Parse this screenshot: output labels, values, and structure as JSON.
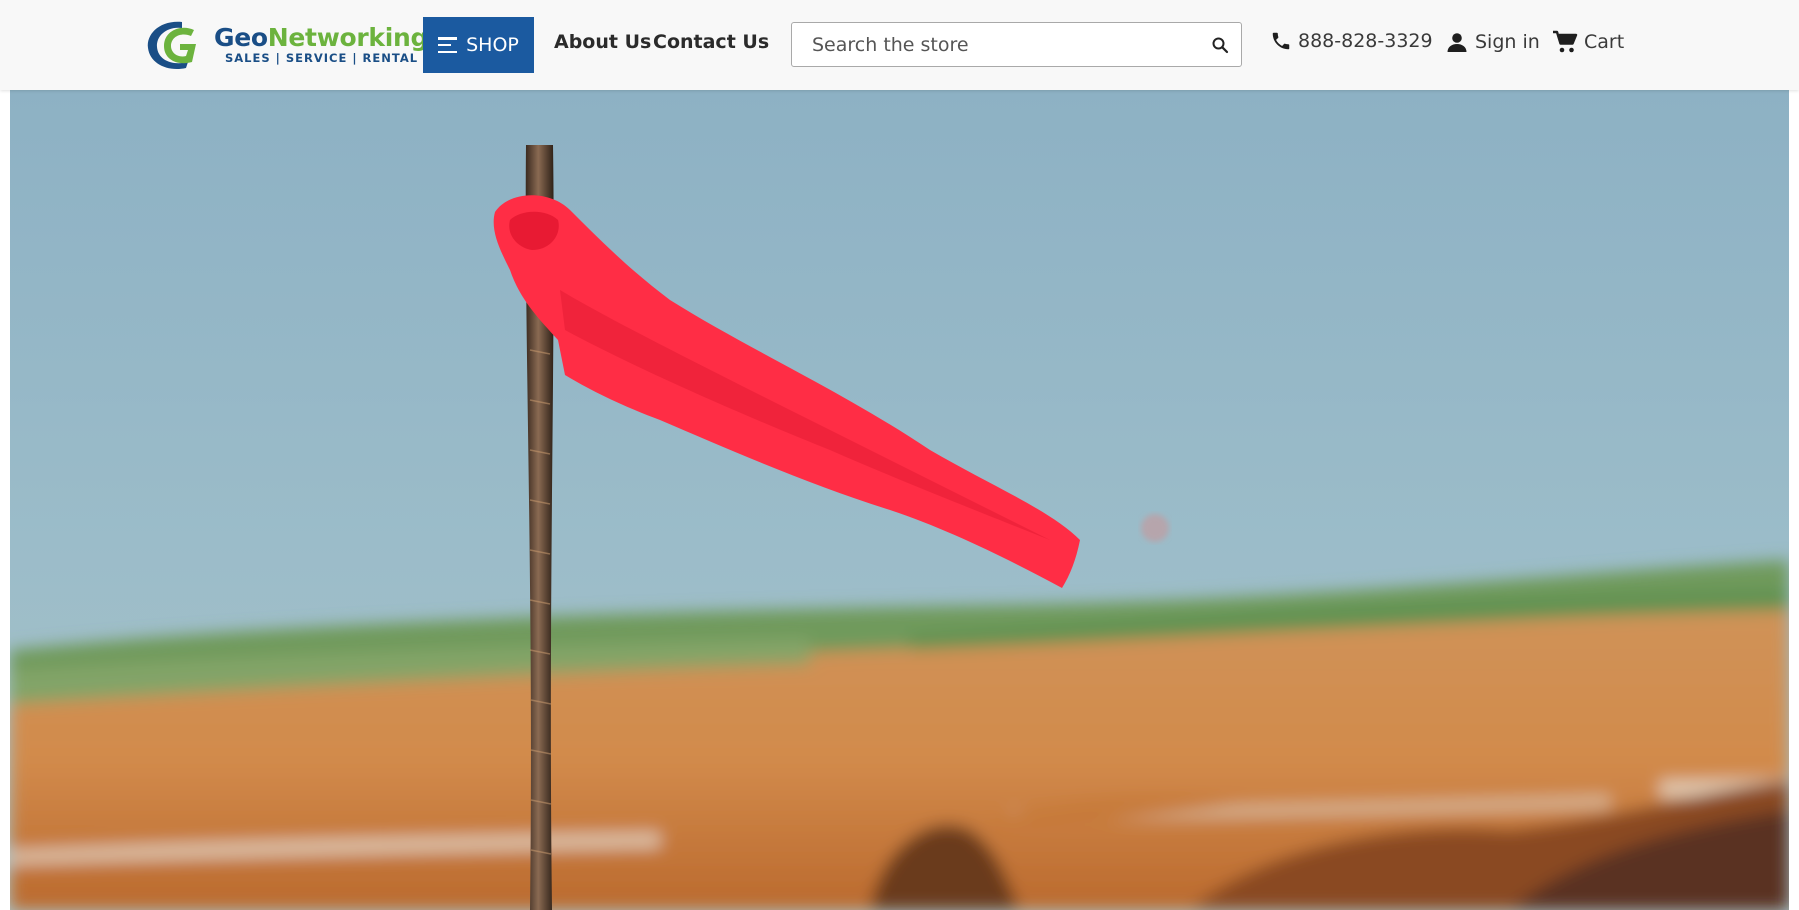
{
  "header": {
    "logo": {
      "name_part1": "Geo",
      "name_part2": "Networking",
      "tagline": "SALES | SERVICE | RENTAL"
    },
    "shop_label": "SHOP",
    "nav": [
      {
        "label": "About Us"
      },
      {
        "label": "Contact Us"
      }
    ],
    "search": {
      "placeholder": "Search the store",
      "value": ""
    },
    "phone": "888-828-3329",
    "signin_label": "Sign in",
    "cart_label": "Cart"
  },
  "hero": {
    "icon": "survey-flag-photo"
  },
  "colors": {
    "brand_blue": "#1b5aa0",
    "brand_green": "#6cb33e",
    "flag_red": "#ff2a42"
  }
}
